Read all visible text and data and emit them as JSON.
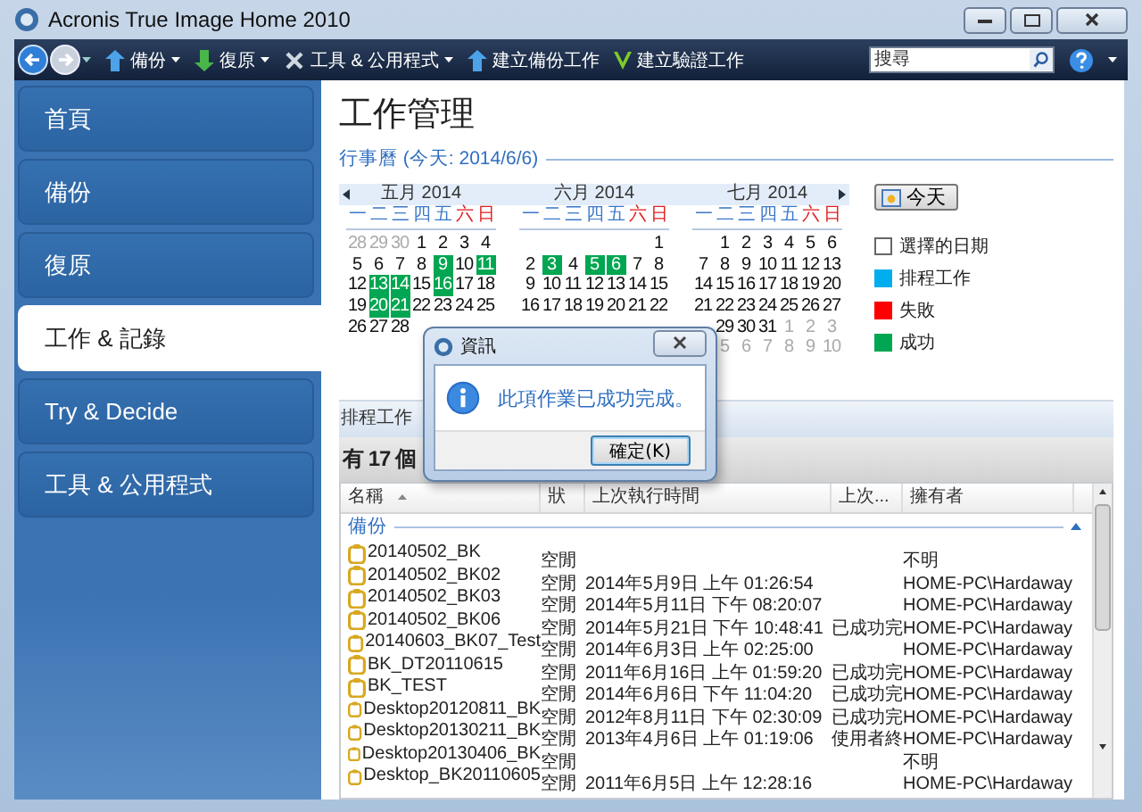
{
  "window": {
    "title": "Acronis True Image Home 2010"
  },
  "toolbar": {
    "items": [
      {
        "label": "備份",
        "kind": "menu"
      },
      {
        "label": "復原",
        "kind": "menu"
      },
      {
        "label": "工具 & 公用程式",
        "kind": "menu"
      },
      {
        "label": "建立備份工作",
        "kind": "backup"
      },
      {
        "label": "建立驗證工作",
        "kind": "validate"
      }
    ],
    "search": {
      "placeholder": "搜尋"
    }
  },
  "sidebar": {
    "items": [
      {
        "label": "首頁",
        "selected": false
      },
      {
        "label": "備份",
        "selected": false
      },
      {
        "label": "復原",
        "selected": false
      },
      {
        "label": "工作 & 記錄",
        "selected": true
      },
      {
        "label": "Try & Decide",
        "selected": false
      },
      {
        "label": "工具 & 公用程式",
        "selected": false
      }
    ]
  },
  "page": {
    "title": "工作管理",
    "calendar_heading": "行事曆 (今天: 2014/6/6)"
  },
  "calendar": {
    "today_button": "今天",
    "months": [
      {
        "title": "五月 2014",
        "weekdays": [
          {
            "label": "一",
            "weekend": false
          },
          {
            "label": "二",
            "weekend": false
          },
          {
            "label": "三",
            "weekend": false
          },
          {
            "label": "四",
            "weekend": false
          },
          {
            "label": "五",
            "weekend": false
          },
          {
            "label": "六",
            "weekend": true
          },
          {
            "label": "日",
            "weekend": true
          }
        ],
        "weeks": [
          [
            {
              "d": "28",
              "kind": "other"
            },
            {
              "d": "29",
              "kind": "other"
            },
            {
              "d": "30",
              "kind": "other"
            },
            {
              "d": "1",
              "kind": "day"
            },
            {
              "d": "2",
              "kind": "day"
            },
            {
              "d": "3",
              "kind": "day"
            },
            {
              "d": "4",
              "kind": "day"
            }
          ],
          [
            {
              "d": "5",
              "kind": "day"
            },
            {
              "d": "6",
              "kind": "day"
            },
            {
              "d": "7",
              "kind": "day"
            },
            {
              "d": "8",
              "kind": "day"
            },
            {
              "d": "9",
              "kind": "success"
            },
            {
              "d": "10",
              "kind": "day"
            },
            {
              "d": "11",
              "kind": "success"
            }
          ],
          [
            {
              "d": "12",
              "kind": "day"
            },
            {
              "d": "13",
              "kind": "success"
            },
            {
              "d": "14",
              "kind": "success"
            },
            {
              "d": "15",
              "kind": "day"
            },
            {
              "d": "16",
              "kind": "success"
            },
            {
              "d": "17",
              "kind": "day"
            },
            {
              "d": "18",
              "kind": "day"
            }
          ],
          [
            {
              "d": "19",
              "kind": "day"
            },
            {
              "d": "20",
              "kind": "success"
            },
            {
              "d": "21",
              "kind": "success"
            },
            {
              "d": "22",
              "kind": "day"
            },
            {
              "d": "23",
              "kind": "day"
            },
            {
              "d": "24",
              "kind": "day"
            },
            {
              "d": "25",
              "kind": "day"
            }
          ],
          [
            {
              "d": "26",
              "kind": "day"
            },
            {
              "d": "27",
              "kind": "day"
            },
            {
              "d": "28",
              "kind": "day"
            },
            {
              "kind": "blank"
            },
            {
              "kind": "blank"
            },
            {
              "kind": "blank"
            },
            {
              "kind": "blank"
            }
          ]
        ]
      },
      {
        "title": "六月 2014",
        "weekdays": [
          {
            "label": "一",
            "weekend": false
          },
          {
            "label": "二",
            "weekend": false
          },
          {
            "label": "三",
            "weekend": false
          },
          {
            "label": "四",
            "weekend": false
          },
          {
            "label": "五",
            "weekend": false
          },
          {
            "label": "六",
            "weekend": true
          },
          {
            "label": "日",
            "weekend": true
          }
        ],
        "weeks": [
          [
            {
              "kind": "blank"
            },
            {
              "kind": "blank"
            },
            {
              "kind": "blank"
            },
            {
              "kind": "blank"
            },
            {
              "kind": "blank"
            },
            {
              "kind": "blank"
            },
            {
              "d": "1",
              "kind": "day"
            }
          ],
          [
            {
              "d": "2",
              "kind": "day"
            },
            {
              "d": "3",
              "kind": "success"
            },
            {
              "d": "4",
              "kind": "day"
            },
            {
              "d": "5",
              "kind": "success"
            },
            {
              "d": "6",
              "kind": "success"
            },
            {
              "d": "7",
              "kind": "day"
            },
            {
              "d": "8",
              "kind": "day"
            }
          ],
          [
            {
              "d": "9",
              "kind": "day"
            },
            {
              "d": "10",
              "kind": "day"
            },
            {
              "d": "11",
              "kind": "day"
            },
            {
              "d": "12",
              "kind": "day"
            },
            {
              "d": "13",
              "kind": "day"
            },
            {
              "d": "14",
              "kind": "day"
            },
            {
              "d": "15",
              "kind": "day"
            }
          ],
          [
            {
              "d": "16",
              "kind": "day"
            },
            {
              "d": "17",
              "kind": "day"
            },
            {
              "d": "18",
              "kind": "day"
            },
            {
              "d": "19",
              "kind": "day"
            },
            {
              "d": "20",
              "kind": "day"
            },
            {
              "d": "21",
              "kind": "day"
            },
            {
              "d": "22",
              "kind": "day"
            }
          ]
        ]
      },
      {
        "title": "七月 2014",
        "weekdays": [
          {
            "label": "一",
            "weekend": false
          },
          {
            "label": "二",
            "weekend": false
          },
          {
            "label": "三",
            "weekend": false
          },
          {
            "label": "四",
            "weekend": false
          },
          {
            "label": "五",
            "weekend": false
          },
          {
            "label": "六",
            "weekend": true
          },
          {
            "label": "日",
            "weekend": true
          }
        ],
        "weeks": [
          [
            {
              "kind": "blank"
            },
            {
              "d": "1",
              "kind": "day"
            },
            {
              "d": "2",
              "kind": "day"
            },
            {
              "d": "3",
              "kind": "day"
            },
            {
              "d": "4",
              "kind": "day"
            },
            {
              "d": "5",
              "kind": "day"
            },
            {
              "d": "6",
              "kind": "day"
            }
          ],
          [
            {
              "d": "7",
              "kind": "day"
            },
            {
              "d": "8",
              "kind": "day"
            },
            {
              "d": "9",
              "kind": "day"
            },
            {
              "d": "10",
              "kind": "day"
            },
            {
              "d": "11",
              "kind": "day"
            },
            {
              "d": "12",
              "kind": "day"
            },
            {
              "d": "13",
              "kind": "day"
            }
          ],
          [
            {
              "d": "14",
              "kind": "day"
            },
            {
              "d": "15",
              "kind": "day"
            },
            {
              "d": "16",
              "kind": "day"
            },
            {
              "d": "17",
              "kind": "day"
            },
            {
              "d": "18",
              "kind": "day"
            },
            {
              "d": "19",
              "kind": "day"
            },
            {
              "d": "20",
              "kind": "day"
            }
          ],
          [
            {
              "d": "21",
              "kind": "day"
            },
            {
              "d": "22",
              "kind": "day"
            },
            {
              "d": "23",
              "kind": "day"
            },
            {
              "d": "24",
              "kind": "day"
            },
            {
              "d": "25",
              "kind": "day"
            },
            {
              "d": "26",
              "kind": "day"
            },
            {
              "d": "27",
              "kind": "day"
            }
          ],
          [
            {
              "kind": "blank"
            },
            {
              "d": "29",
              "kind": "day"
            },
            {
              "d": "30",
              "kind": "day"
            },
            {
              "d": "31",
              "kind": "day"
            },
            {
              "d": "1",
              "kind": "other"
            },
            {
              "d": "2",
              "kind": "other"
            },
            {
              "d": "3",
              "kind": "other"
            }
          ],
          [
            {
              "kind": "blank"
            },
            {
              "d": "5",
              "kind": "other"
            },
            {
              "d": "6",
              "kind": "other"
            },
            {
              "d": "7",
              "kind": "other"
            },
            {
              "d": "8",
              "kind": "other"
            },
            {
              "d": "9",
              "kind": "other"
            },
            {
              "d": "10",
              "kind": "other"
            }
          ]
        ]
      }
    ]
  },
  "legend": [
    {
      "label": "選擇的日期",
      "color": "#ffffff"
    },
    {
      "label": "排程工作",
      "color": "#00aeef"
    },
    {
      "label": "失敗",
      "color": "#ff0000"
    },
    {
      "label": "成功",
      "color": "#00a651"
    }
  ],
  "tabs": [
    {
      "label": "排程工作",
      "selected": false
    }
  ],
  "jobs": {
    "count_text": "有 17 個",
    "columns": [
      {
        "label": "名稱",
        "sorted": true
      },
      {
        "label": "狀",
        "sorted": false
      },
      {
        "label": "上次執行時間",
        "sorted": false
      },
      {
        "label": "上次...",
        "sorted": false
      },
      {
        "label": "擁有者",
        "sorted": false
      }
    ],
    "group": "備份",
    "rows": [
      {
        "name": "20140502_BK",
        "status": "空閒",
        "owner": "不明"
      },
      {
        "name": "20140502_BK02",
        "status": "空閒",
        "last_run": "2014年5月9日 上午 01:26:54",
        "owner": "HOME-PC\\Hardaway"
      },
      {
        "name": "20140502_BK03",
        "status": "空閒",
        "last_run": "2014年5月11日 下午 08:20:07",
        "owner": "HOME-PC\\Hardaway"
      },
      {
        "name": "20140502_BK06",
        "status": "空閒",
        "last_run": "2014年5月21日 下午 10:48:41",
        "result": "已成功完",
        "owner": "HOME-PC\\Hardaway"
      },
      {
        "name": "20140603_BK07_Test",
        "status": "空閒",
        "last_run": "2014年6月3日 上午 02:25:00",
        "owner": "HOME-PC\\Hardaway"
      },
      {
        "name": "BK_DT20110615",
        "status": "空閒",
        "last_run": "2011年6月16日 上午 01:59:20",
        "result": "已成功完",
        "owner": "HOME-PC\\Hardaway"
      },
      {
        "name": "BK_TEST",
        "status": "空閒",
        "last_run": "2014年6月6日 下午 11:04:20",
        "result": "已成功完",
        "owner": "HOME-PC\\Hardaway"
      },
      {
        "name": "Desktop20120811_BK",
        "status": "空閒",
        "last_run": "2012年8月11日 下午 02:30:09",
        "result": "已成功完",
        "owner": "HOME-PC\\Hardaway"
      },
      {
        "name": "Desktop20130211_BK",
        "status": "空閒",
        "last_run": "2013年4月6日 上午 01:19:06",
        "result": "使用者終",
        "owner": "HOME-PC\\Hardaway"
      },
      {
        "name": "Desktop20130406_BK",
        "status": "空閒",
        "owner": "不明"
      },
      {
        "name": "Desktop_BK20110605",
        "status": "空閒",
        "last_run": "2011年6月5日 上午 12:28:16",
        "owner": "HOME-PC\\Hardaway"
      }
    ]
  },
  "dialog": {
    "title": "資訊",
    "message": "此項作業已成功完成。",
    "button": "確定(K)"
  }
}
